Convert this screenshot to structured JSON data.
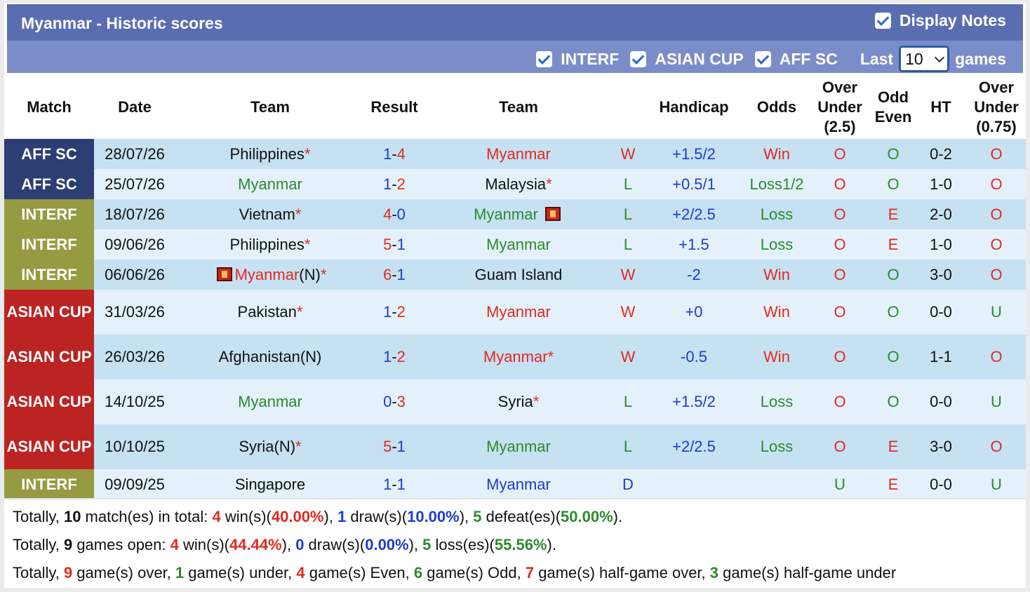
{
  "header": {
    "title": "Myanmar - Historic scores",
    "display_notes": "Display Notes",
    "filters": [
      "INTERF",
      "ASIAN CUP",
      "AFF SC"
    ],
    "last_label": "Last",
    "last_value": "10",
    "games_label": "games"
  },
  "columns": [
    "Match",
    "Date",
    "Team",
    "Result",
    "Team",
    "",
    "Handicap",
    "Odds",
    "Over\nUnder\n(2.5)",
    "Odd\nEven",
    "HT",
    "Over\nUnder\n(0.75)"
  ],
  "rows": [
    {
      "match": "AFF SC",
      "badge": "aff",
      "date": "28/07/26",
      "home": "Philippines",
      "home_color": "dark",
      "home_star": "*",
      "home_flag": false,
      "rh": "1",
      "rh_color": "blue",
      "ra": "4",
      "ra_color": "red",
      "away": "Myanmar",
      "away_color": "red",
      "away_star": "",
      "away_flag": false,
      "wl": "W",
      "wl_color": "red",
      "handicap": "+1.5/2",
      "odds": "Win",
      "odds_color": "red",
      "ou": "O",
      "ou_color": "red",
      "oe": "O",
      "oe_color": "green",
      "ht": "0-2",
      "ou2": "O",
      "ou2_color": "red",
      "tall": false
    },
    {
      "match": "AFF SC",
      "badge": "aff",
      "date": "25/07/26",
      "home": "Myanmar",
      "home_color": "green",
      "home_star": "",
      "home_flag": false,
      "rh": "1",
      "rh_color": "blue",
      "ra": "2",
      "ra_color": "red",
      "away": "Malaysia",
      "away_color": "dark",
      "away_star": "*",
      "away_flag": false,
      "wl": "L",
      "wl_color": "green",
      "handicap": "+0.5/1",
      "odds": "Loss1/2",
      "odds_color": "green",
      "ou": "O",
      "ou_color": "red",
      "oe": "O",
      "oe_color": "green",
      "ht": "1-0",
      "ou2": "O",
      "ou2_color": "red",
      "tall": false
    },
    {
      "match": "INTERF",
      "badge": "interf",
      "date": "18/07/26",
      "home": "Vietnam",
      "home_color": "dark",
      "home_star": "*",
      "home_flag": false,
      "rh": "4",
      "rh_color": "red",
      "ra": "0",
      "ra_color": "blue",
      "away": "Myanmar",
      "away_color": "green",
      "away_star": "",
      "away_flag": true,
      "wl": "L",
      "wl_color": "green",
      "handicap": "+2/2.5",
      "odds": "Loss",
      "odds_color": "green",
      "ou": "O",
      "ou_color": "red",
      "oe": "E",
      "oe_color": "red",
      "ht": "2-0",
      "ou2": "O",
      "ou2_color": "red",
      "tall": false
    },
    {
      "match": "INTERF",
      "badge": "interf",
      "date": "09/06/26",
      "home": "Philippines",
      "home_color": "dark",
      "home_star": "*",
      "home_flag": false,
      "rh": "5",
      "rh_color": "red",
      "ra": "1",
      "ra_color": "blue",
      "away": "Myanmar",
      "away_color": "green",
      "away_star": "",
      "away_flag": false,
      "wl": "L",
      "wl_color": "green",
      "handicap": "+1.5",
      "odds": "Loss",
      "odds_color": "green",
      "ou": "O",
      "ou_color": "red",
      "oe": "E",
      "oe_color": "red",
      "ht": "1-0",
      "ou2": "O",
      "ou2_color": "red",
      "tall": false
    },
    {
      "match": "INTERF",
      "badge": "interf",
      "date": "06/06/26",
      "home": "Myanmar",
      "home_color": "red",
      "home_suffix": "(N)",
      "home_star": "*",
      "home_flag": true,
      "rh": "6",
      "rh_color": "red",
      "ra": "1",
      "ra_color": "blue",
      "away": "Guam Island",
      "away_color": "dark",
      "away_star": "",
      "away_flag": false,
      "wl": "W",
      "wl_color": "red",
      "handicap": "-2",
      "odds": "Win",
      "odds_color": "red",
      "ou": "O",
      "ou_color": "red",
      "oe": "O",
      "oe_color": "green",
      "ht": "3-0",
      "ou2": "O",
      "ou2_color": "red",
      "tall": false
    },
    {
      "match": "ASIAN CUP",
      "badge": "asian",
      "date": "31/03/26",
      "home": "Pakistan",
      "home_color": "dark",
      "home_star": "*",
      "home_flag": false,
      "rh": "1",
      "rh_color": "blue",
      "ra": "2",
      "ra_color": "red",
      "away": "Myanmar",
      "away_color": "red",
      "away_star": "",
      "away_flag": false,
      "wl": "W",
      "wl_color": "red",
      "handicap": "+0",
      "odds": "Win",
      "odds_color": "red",
      "ou": "O",
      "ou_color": "red",
      "oe": "O",
      "oe_color": "green",
      "ht": "0-0",
      "ou2": "U",
      "ou2_color": "green",
      "tall": true
    },
    {
      "match": "ASIAN CUP",
      "badge": "asian",
      "date": "26/03/26",
      "home": "Afghanistan(N)",
      "home_color": "dark",
      "home_star": "",
      "home_flag": false,
      "rh": "1",
      "rh_color": "blue",
      "ra": "2",
      "ra_color": "red",
      "away": "Myanmar",
      "away_color": "red",
      "away_star": "*",
      "away_flag": false,
      "wl": "W",
      "wl_color": "red",
      "handicap": "-0.5",
      "odds": "Win",
      "odds_color": "red",
      "ou": "O",
      "ou_color": "red",
      "oe": "O",
      "oe_color": "green",
      "ht": "1-1",
      "ou2": "O",
      "ou2_color": "red",
      "tall": true
    },
    {
      "match": "ASIAN CUP",
      "badge": "asian",
      "date": "14/10/25",
      "home": "Myanmar",
      "home_color": "green",
      "home_star": "",
      "home_flag": false,
      "rh": "0",
      "rh_color": "blue",
      "ra": "3",
      "ra_color": "red",
      "away": "Syria",
      "away_color": "dark",
      "away_star": "*",
      "away_flag": false,
      "wl": "L",
      "wl_color": "green",
      "handicap": "+1.5/2",
      "odds": "Loss",
      "odds_color": "green",
      "ou": "O",
      "ou_color": "red",
      "oe": "O",
      "oe_color": "green",
      "ht": "0-0",
      "ou2": "U",
      "ou2_color": "green",
      "tall": true
    },
    {
      "match": "ASIAN CUP",
      "badge": "asian",
      "date": "10/10/25",
      "home": "Syria(N)",
      "home_color": "dark",
      "home_star": "*",
      "home_flag": false,
      "rh": "5",
      "rh_color": "red",
      "ra": "1",
      "ra_color": "blue",
      "away": "Myanmar",
      "away_color": "green",
      "away_star": "",
      "away_flag": false,
      "wl": "L",
      "wl_color": "green",
      "handicap": "+2/2.5",
      "odds": "Loss",
      "odds_color": "green",
      "ou": "O",
      "ou_color": "red",
      "oe": "E",
      "oe_color": "red",
      "ht": "3-0",
      "ou2": "O",
      "ou2_color": "red",
      "tall": true
    },
    {
      "match": "INTERF",
      "badge": "interf",
      "date": "09/09/25",
      "home": "Singapore",
      "home_color": "dark",
      "home_star": "",
      "home_flag": false,
      "rh": "1",
      "rh_color": "blue",
      "ra": "1",
      "ra_color": "blue",
      "away": "Myanmar",
      "away_color": "blue",
      "away_star": "",
      "away_flag": false,
      "wl": "D",
      "wl_color": "blue",
      "handicap": "",
      "odds": "",
      "odds_color": "dark",
      "ou": "U",
      "ou_color": "green",
      "oe": "E",
      "oe_color": "red",
      "ht": "0-0",
      "ou2": "U",
      "ou2_color": "green",
      "tall": false
    }
  ],
  "summary": [
    [
      {
        "t": "Totally, ",
        "c": ""
      },
      {
        "t": "10",
        "c": "dark",
        "b": true
      },
      {
        "t": " match(es) in total: ",
        "c": ""
      },
      {
        "t": "4",
        "c": "red",
        "b": true
      },
      {
        "t": " win(s)(",
        "c": ""
      },
      {
        "t": "40.00%",
        "c": "red",
        "b": true
      },
      {
        "t": "), ",
        "c": ""
      },
      {
        "t": "1",
        "c": "blue",
        "b": true
      },
      {
        "t": " draw(s)(",
        "c": ""
      },
      {
        "t": "10.00%",
        "c": "blue",
        "b": true
      },
      {
        "t": "), ",
        "c": ""
      },
      {
        "t": "5",
        "c": "green",
        "b": true
      },
      {
        "t": " defeat(es)(",
        "c": ""
      },
      {
        "t": "50.00%",
        "c": "green",
        "b": true
      },
      {
        "t": ").",
        "c": ""
      }
    ],
    [
      {
        "t": "Totally, ",
        "c": ""
      },
      {
        "t": "9",
        "c": "dark",
        "b": true
      },
      {
        "t": " games open: ",
        "c": ""
      },
      {
        "t": "4",
        "c": "red",
        "b": true
      },
      {
        "t": " win(s)(",
        "c": ""
      },
      {
        "t": "44.44%",
        "c": "red",
        "b": true
      },
      {
        "t": "), ",
        "c": ""
      },
      {
        "t": "0",
        "c": "blue",
        "b": true
      },
      {
        "t": " draw(s)(",
        "c": ""
      },
      {
        "t": "0.00%",
        "c": "blue",
        "b": true
      },
      {
        "t": "), ",
        "c": ""
      },
      {
        "t": "5",
        "c": "green",
        "b": true
      },
      {
        "t": " loss(es)(",
        "c": ""
      },
      {
        "t": "55.56%",
        "c": "green",
        "b": true
      },
      {
        "t": ").",
        "c": ""
      }
    ],
    [
      {
        "t": "Totally, ",
        "c": ""
      },
      {
        "t": "9",
        "c": "red",
        "b": true
      },
      {
        "t": " game(s) over, ",
        "c": ""
      },
      {
        "t": "1",
        "c": "green",
        "b": true
      },
      {
        "t": " game(s) under, ",
        "c": ""
      },
      {
        "t": "4",
        "c": "red",
        "b": true
      },
      {
        "t": " game(s) Even, ",
        "c": ""
      },
      {
        "t": "6",
        "c": "green",
        "b": true
      },
      {
        "t": " game(s) Odd, ",
        "c": ""
      },
      {
        "t": "7",
        "c": "red",
        "b": true
      },
      {
        "t": " game(s) half-game over, ",
        "c": ""
      },
      {
        "t": "3",
        "c": "green",
        "b": true
      },
      {
        "t": " game(s) half-game under",
        "c": ""
      }
    ]
  ]
}
